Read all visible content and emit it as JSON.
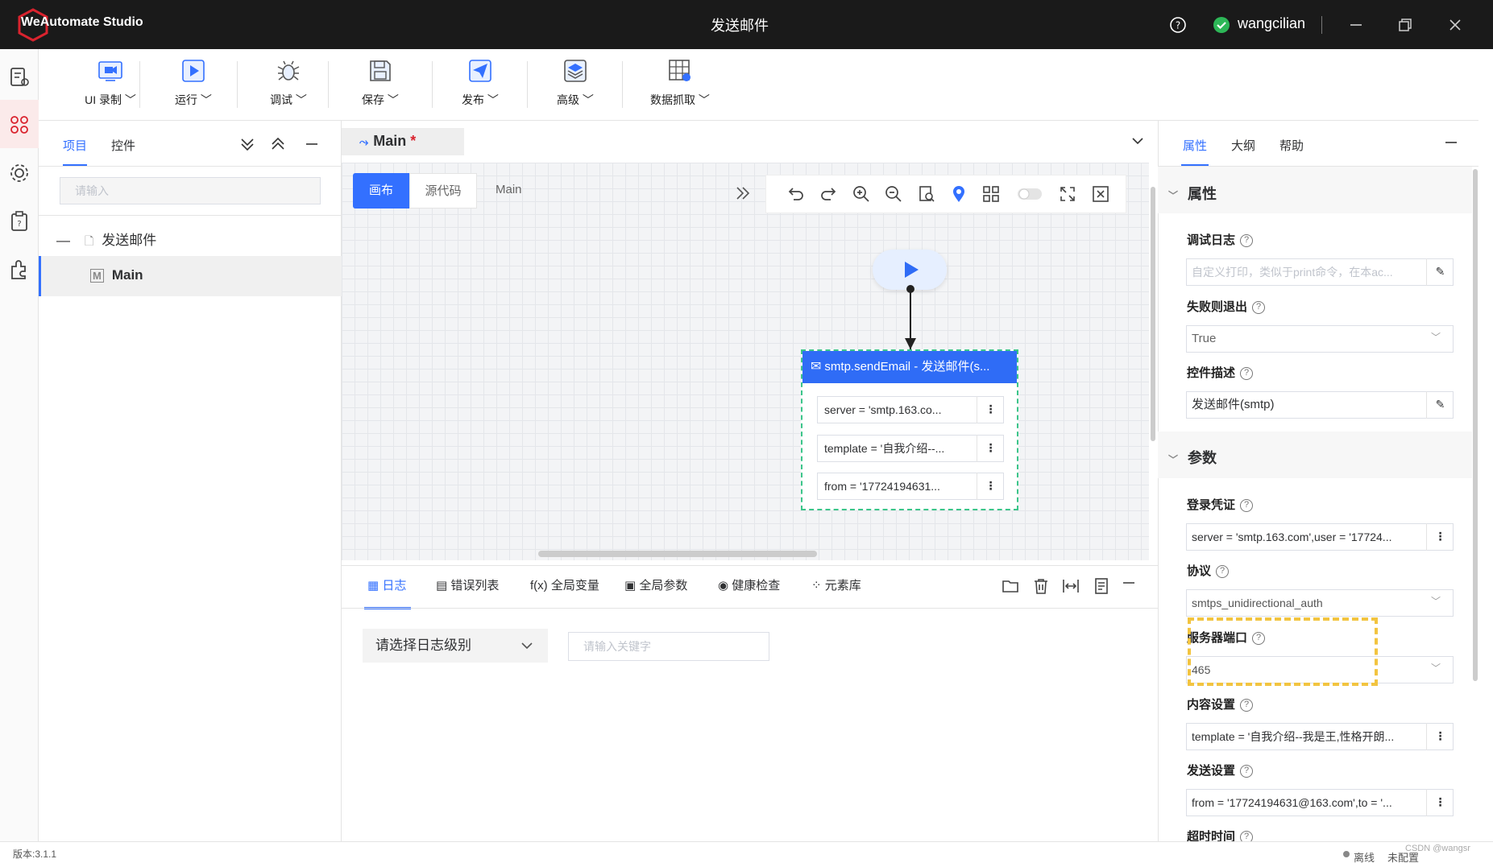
{
  "app": {
    "logo_text": "WeAutomate Studio",
    "title": "发送邮件",
    "user": "wangcilian"
  },
  "toolbar": [
    {
      "label": "UI 录制",
      "icon": "record-icon"
    },
    {
      "label": "运行",
      "icon": "run-icon"
    },
    {
      "label": "调试",
      "icon": "debug-icon"
    },
    {
      "label": "保存",
      "icon": "save-icon"
    },
    {
      "label": "发布",
      "icon": "publish-icon"
    },
    {
      "label": "高级",
      "icon": "advanced-icon"
    },
    {
      "label": "数据抓取",
      "icon": "data-scrape-icon"
    }
  ],
  "project": {
    "tabs": [
      "项目",
      "控件"
    ],
    "search_placeholder": "请输入",
    "tree_root": "发送邮件",
    "tree_child": "Main"
  },
  "editor": {
    "tab_label": "Main",
    "tab_modified": "*",
    "mode_canvas": "画布",
    "mode_source": "源代码",
    "breadcrumb": "Main"
  },
  "flow": {
    "node_title": "smtp.sendEmail - 发送邮件(s...",
    "params": [
      "server = 'smtp.163.co...",
      "template = '自我介绍--...",
      "from = '17724194631..."
    ],
    "param_menu": "⋮"
  },
  "bottom": {
    "tabs": [
      "日志",
      "错误列表",
      "全局变量",
      "全局参数",
      "健康检查",
      "元素库"
    ],
    "log_level": "请选择日志级别",
    "keyword_placeholder": "请输入关键字"
  },
  "right": {
    "tabs": [
      "属性",
      "大纲",
      "帮助"
    ],
    "section_props": "属性",
    "section_params": "参数",
    "debug_log_label": "调试日志",
    "debug_log_placeholder": "自定义打印，类似于print命令，在本ac...",
    "exit_on_fail_label": "失败则退出",
    "exit_on_fail_value": "True",
    "desc_label": "控件描述",
    "desc_value": "发送邮件(smtp)",
    "cred_label": "登录凭证",
    "cred_value": "server = 'smtp.163.com',user = '17724...",
    "protocol_label": "协议",
    "protocol_value": "smtps_unidirectional_auth",
    "port_label": "服务器端口",
    "port_value": "465",
    "content_label": "内容设置",
    "content_value": "template = '自我介绍--我是王,性格开朗...",
    "send_label": "发送设置",
    "send_value": "from = '17724194631@163.com',to = '...",
    "timeout_label": "超时时间",
    "help_mark": "?",
    "field_menu": "⋮"
  },
  "status": {
    "version": "版本:3.1.1",
    "offline": "离线",
    "unconfigured": "未配置",
    "watermark": "CSDN @wangsr"
  },
  "colors": {
    "primary": "#3370ff",
    "node_header": "#2f6cf6",
    "highlight": "#f2c440",
    "titlebar": "#1a1a1a"
  }
}
